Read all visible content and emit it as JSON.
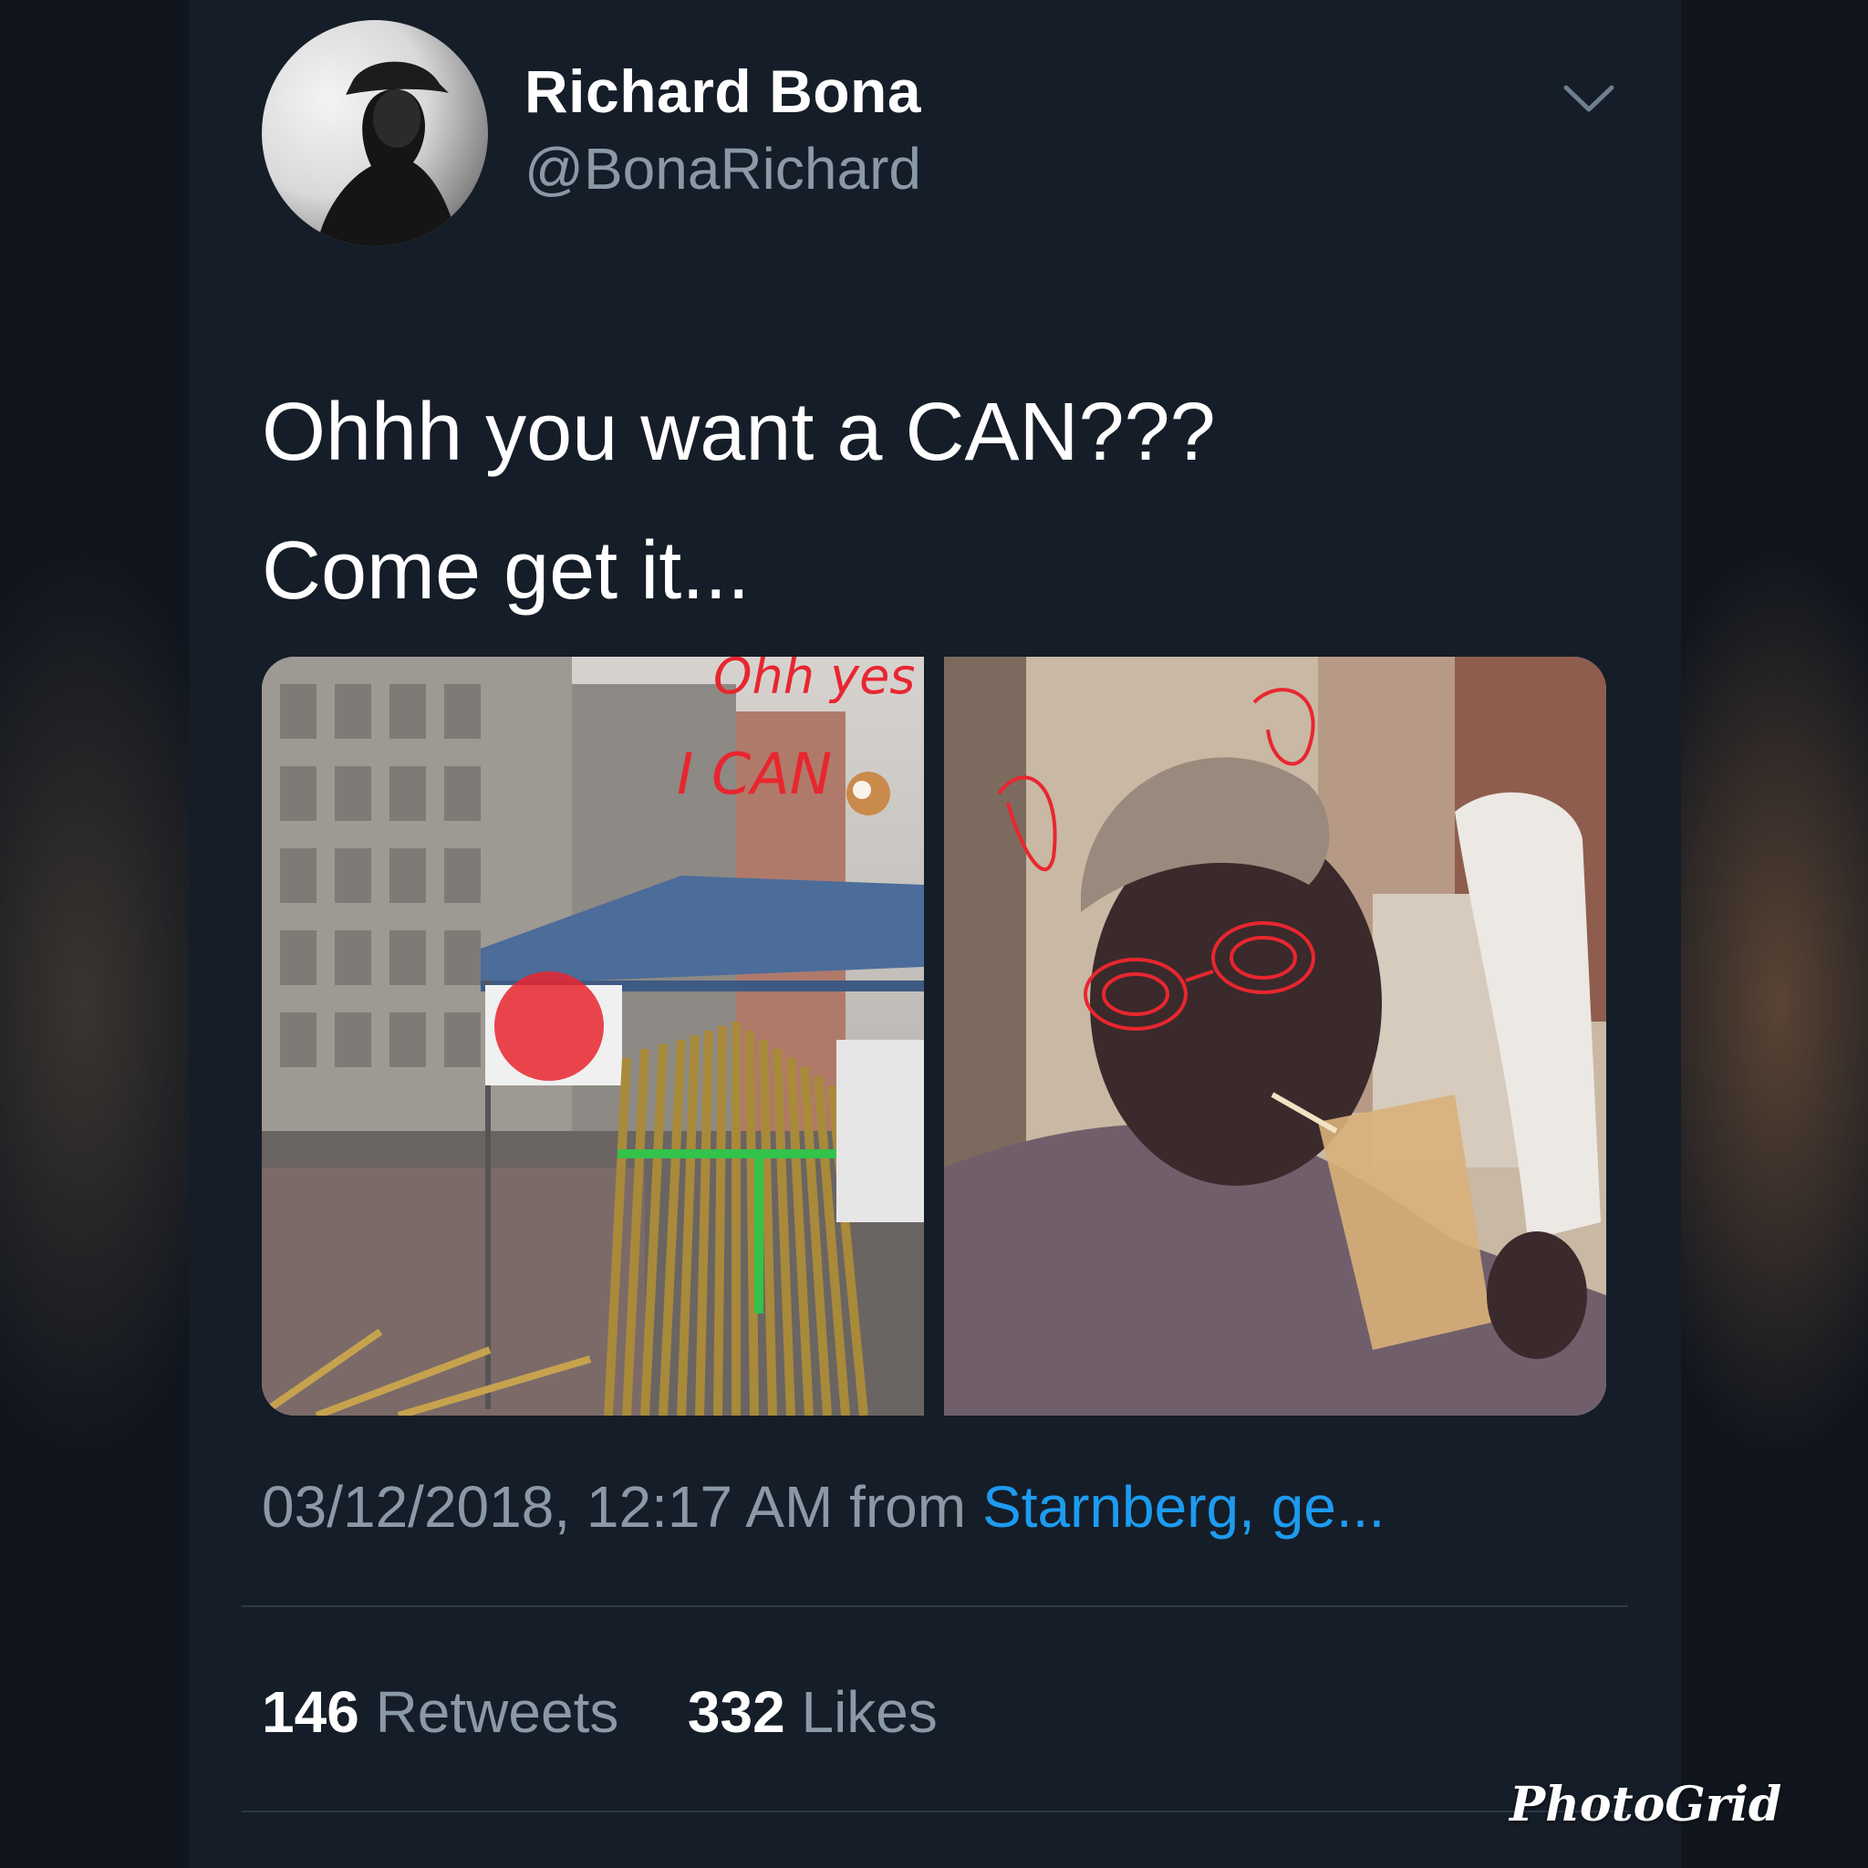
{
  "tweet": {
    "display_name": "Richard Bona",
    "handle": "@BonaRichard",
    "text_lines": [
      "Ohhh you want a CAN???",
      "Come get it..."
    ],
    "images": {
      "left_overlay_line1": "Ohh yes",
      "left_overlay_line2": "I CAN"
    },
    "timestamp": "03/12/2018, 12:17 AM from",
    "location": "Starnberg, ge...",
    "retweets_count": "146",
    "retweets_label": "Retweets",
    "likes_count": "332",
    "likes_label": "Likes"
  },
  "watermark": "PhotoGrid",
  "icons": {
    "menu": "chevron-down-icon",
    "ok_hand": "ok-hand-emoji-icon"
  },
  "colors": {
    "background": "#151d28",
    "text_primary": "#ffffff",
    "text_secondary": "#8b99a7",
    "link": "#1d9bf0",
    "overlay_red": "#e8262f"
  }
}
